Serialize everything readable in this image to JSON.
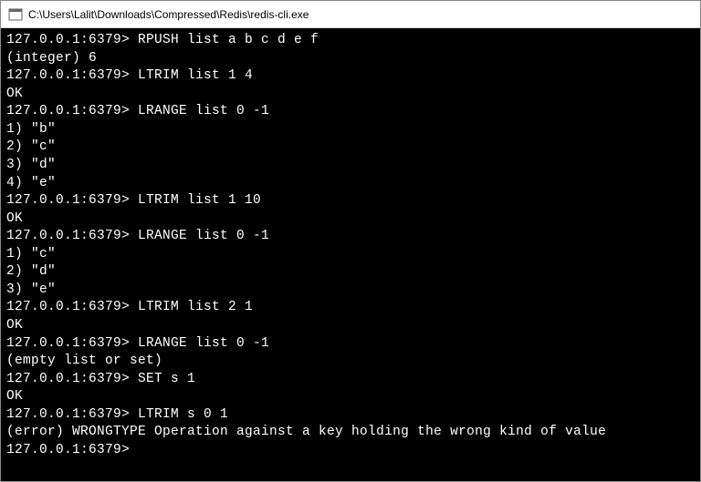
{
  "window": {
    "title": "C:\\Users\\Lalit\\Downloads\\Compressed\\Redis\\redis-cli.exe"
  },
  "prompt": "127.0.0.1:6379>",
  "lines": [
    "127.0.0.1:6379> RPUSH list a b c d e f",
    "(integer) 6",
    "127.0.0.1:6379> LTRIM list 1 4",
    "OK",
    "127.0.0.1:6379> LRANGE list 0 -1",
    "1) \"b\"",
    "2) \"c\"",
    "3) \"d\"",
    "4) \"e\"",
    "127.0.0.1:6379> LTRIM list 1 10",
    "OK",
    "127.0.0.1:6379> LRANGE list 0 -1",
    "1) \"c\"",
    "2) \"d\"",
    "3) \"e\"",
    "127.0.0.1:6379> LTRIM list 2 1",
    "OK",
    "127.0.0.1:6379> LRANGE list 0 -1",
    "(empty list or set)",
    "127.0.0.1:6379> SET s 1",
    "OK",
    "127.0.0.1:6379> LTRIM s 0 1",
    "(error) WRONGTYPE Operation against a key holding the wrong kind of value",
    "127.0.0.1:6379>"
  ]
}
